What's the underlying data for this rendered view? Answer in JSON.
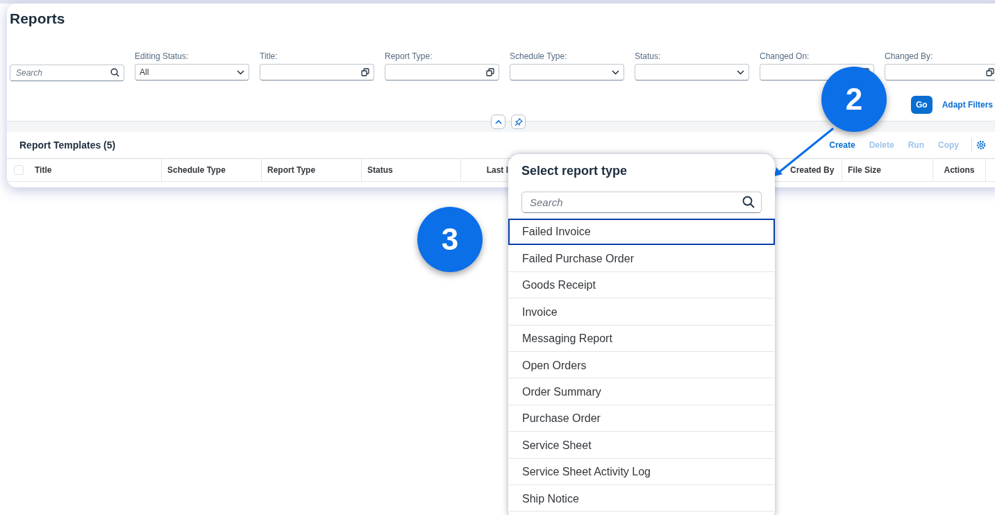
{
  "page": {
    "title": "Reports"
  },
  "filter_bar": {
    "search": {
      "placeholder": "Search"
    },
    "filters": [
      {
        "label": "Editing Status:",
        "kind": "select",
        "value": "All"
      },
      {
        "label": "Title:",
        "kind": "valuehelp"
      },
      {
        "label": "Report Type:",
        "kind": "valuehelp"
      },
      {
        "label": "Schedule Type:",
        "kind": "select"
      },
      {
        "label": "Status:",
        "kind": "select"
      },
      {
        "label": "Changed On:",
        "kind": "valuehelp"
      },
      {
        "label": "Changed By:",
        "kind": "valuehelp"
      }
    ],
    "go_button": "Go",
    "adapt_filters": "Adapt Filters"
  },
  "table": {
    "title": "Report Templates (5)",
    "actions": [
      {
        "label": "Create",
        "disabled": false
      },
      {
        "label": "Delete",
        "disabled": true
      },
      {
        "label": "Run",
        "disabled": true
      },
      {
        "label": "Copy",
        "disabled": true
      }
    ],
    "select_all": {
      "checked": false
    },
    "columns": [
      "Title",
      "Schedule Type",
      "Report Type",
      "Status",
      "Last I",
      "Created By",
      "File Size",
      "Actions"
    ]
  },
  "popover": {
    "title": "Select report type",
    "search": {
      "placeholder": "Search"
    },
    "items": [
      {
        "label": "Failed Invoice",
        "selected": true
      },
      {
        "label": "Failed Purchase Order",
        "selected": false
      },
      {
        "label": "Goods Receipt",
        "selected": false
      },
      {
        "label": "Invoice",
        "selected": false
      },
      {
        "label": "Messaging Report",
        "selected": false
      },
      {
        "label": "Open Orders",
        "selected": false
      },
      {
        "label": "Order Summary",
        "selected": false
      },
      {
        "label": "Purchase Order",
        "selected": false
      },
      {
        "label": "Service Sheet",
        "selected": false
      },
      {
        "label": "Service Sheet Activity Log",
        "selected": false
      },
      {
        "label": "Ship Notice",
        "selected": false
      }
    ]
  },
  "callouts": [
    {
      "label": "2"
    },
    {
      "label": "3"
    }
  ]
}
